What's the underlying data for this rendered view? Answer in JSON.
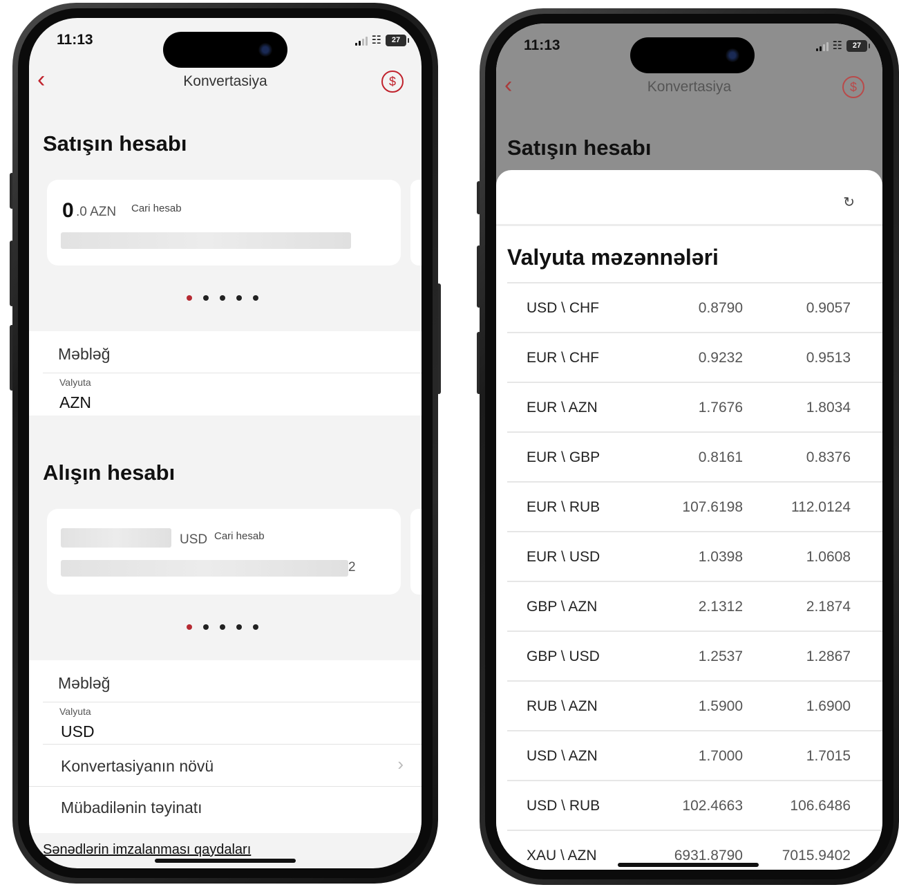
{
  "left_screen": {
    "status": {
      "time": "11:13",
      "battery": "27"
    },
    "nav": {
      "back_icon": "chevron-left-icon",
      "title": "Konvertasiya",
      "action_icon": "currency-exchange-icon"
    },
    "sell": {
      "title": "Satışın hesabı",
      "card": {
        "amount_big": "0",
        "amount_small": ".0 AZN",
        "account_type": "Cari hesab"
      },
      "amount_label": "Məbləğ",
      "currency_label": "Valyuta",
      "currency_value": "AZN"
    },
    "buy": {
      "title": "Alışın hesabı",
      "card": {
        "currency": "USD",
        "account_type": "Cari hesab",
        "trailing_digit": "2"
      },
      "amount_label": "Məbləğ",
      "currency_label": "Valyuta",
      "currency_value": "USD"
    },
    "conversion_type_label": "Konvertasiyanın növü",
    "purpose_label": "Mübadilənin təyinatı",
    "rules_link": "Sənədlərin imzalanması qaydaları"
  },
  "right_screen": {
    "status": {
      "time": "11:13",
      "battery": "27"
    },
    "nav": {
      "title": "Konvertasiya"
    },
    "background_title": "Satışın hesabı",
    "sheet": {
      "refresh_icon": "refresh-icon",
      "title": "Valyuta məzənnələri",
      "rates": [
        {
          "pair": "USD \\ CHF",
          "buy": "0.8790",
          "sell": "0.9057"
        },
        {
          "pair": "EUR \\ CHF",
          "buy": "0.9232",
          "sell": "0.9513"
        },
        {
          "pair": "EUR \\ AZN",
          "buy": "1.7676",
          "sell": "1.8034"
        },
        {
          "pair": "EUR \\ GBP",
          "buy": "0.8161",
          "sell": "0.8376"
        },
        {
          "pair": "EUR \\ RUB",
          "buy": "107.6198",
          "sell": "112.0124"
        },
        {
          "pair": "EUR \\ USD",
          "buy": "1.0398",
          "sell": "1.0608"
        },
        {
          "pair": "GBP \\ AZN",
          "buy": "2.1312",
          "sell": "2.1874"
        },
        {
          "pair": "GBP \\ USD",
          "buy": "1.2537",
          "sell": "1.2867"
        },
        {
          "pair": "RUB \\ AZN",
          "buy": "1.5900",
          "sell": "1.6900"
        },
        {
          "pair": "USD \\ AZN",
          "buy": "1.7000",
          "sell": "1.7015"
        },
        {
          "pair": "USD \\ RUB",
          "buy": "102.4663",
          "sell": "106.6486"
        },
        {
          "pair": "XAU \\ AZN",
          "buy": "6931.8790",
          "sell": "7015.9402"
        }
      ]
    }
  },
  "colors": {
    "accent": "#c0232d",
    "screen_bg": "#f3f3f3",
    "dim_overlay": "#8e8e8e"
  }
}
